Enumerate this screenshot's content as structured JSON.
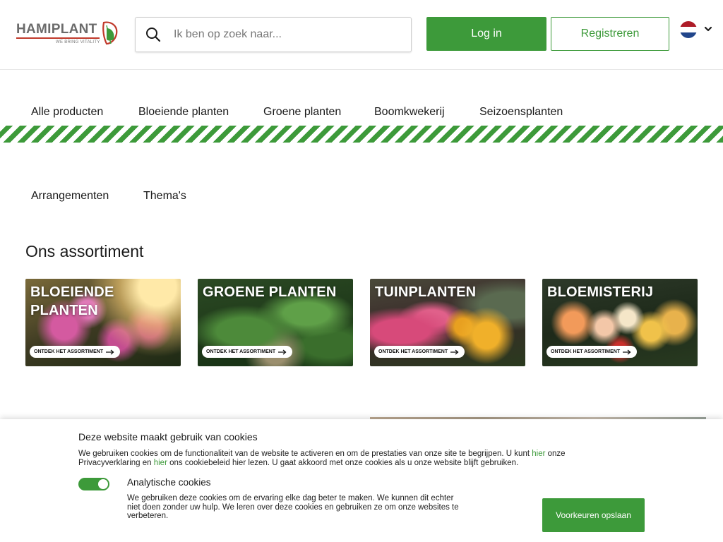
{
  "header": {
    "logo_text": "HAMIPLANT",
    "logo_tagline": "WE BRING VITALITY",
    "search_placeholder": "Ik ben op zoek naar...",
    "login_label": "Log in",
    "register_label": "Registreren",
    "language": "nl-flag-icon"
  },
  "nav": {
    "primary": [
      "Alle producten",
      "Bloeiende planten",
      "Groene planten",
      "Boomkwekerij",
      "Seizoensplanten"
    ],
    "secondary": [
      "Arrangementen",
      "Thema's"
    ]
  },
  "assortment": {
    "title": "Ons assortiment",
    "cards": [
      {
        "title": "BLOEIENDE PLANTEN",
        "cta": "ONTDEK HET ASSORTIMENT"
      },
      {
        "title": "GROENE PLANTEN",
        "cta": "ONTDEK HET ASSORTIMENT"
      },
      {
        "title": "TUINPLANTEN",
        "cta": "ONTDEK HET ASSORTIMENT"
      },
      {
        "title": "BLOEMISTERIJ",
        "cta": "ONTDEK HET ASSORTIMENT"
      }
    ]
  },
  "cookie": {
    "title": "Deze website maakt gebruik van cookies",
    "text_part1": "We gebruiken cookies om de functionaliteit van de website te activeren en om de prestaties van onze site te begrijpen. U kunt ",
    "link1": "hier",
    "text_part2": " onze Privacyverklaring en ",
    "link2": "hier",
    "text_part3": " ons cookiebeleid hier lezen. U gaat akkoord met onze cookies als u onze website blijft gebruiken.",
    "analytics_label": "Analytische cookies",
    "analytics_enabled": true,
    "analytics_text": "We gebruiken deze cookies om de ervaring elke dag beter te maken. We kunnen dit echter niet doen zonder uw hulp. We leren over deze cookies en gebruiken ze om onze websites te verbeteren.",
    "save_label": "Voorkeuren opslaan"
  },
  "colors": {
    "brand_green": "#3d9a3a",
    "logo_red": "#c0392b"
  }
}
